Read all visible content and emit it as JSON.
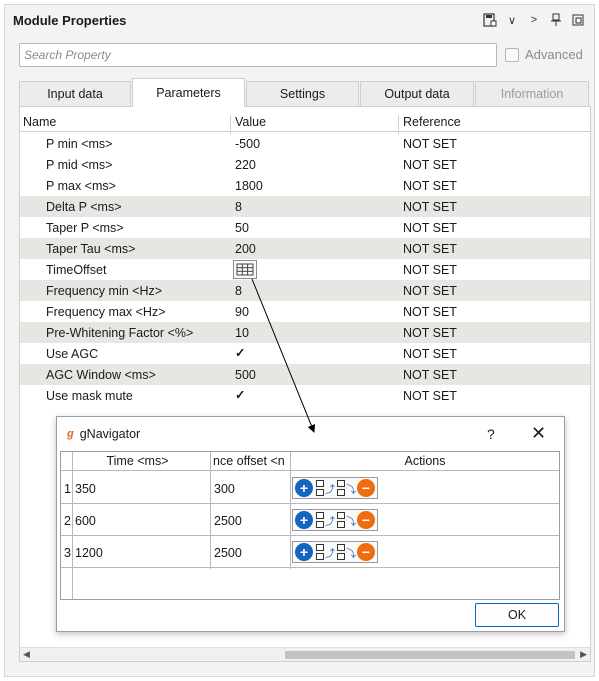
{
  "panel": {
    "title": "Module Properties",
    "toolbar_icons": [
      "save-icon",
      "chevron-down-icon",
      "chevron-right-icon",
      "pin-icon",
      "float-window-icon"
    ]
  },
  "search": {
    "placeholder": "Search Property"
  },
  "advanced": {
    "label": "Advanced",
    "checked": false
  },
  "tabs": [
    {
      "label": "Input data",
      "active": false,
      "enabled": true
    },
    {
      "label": "Parameters",
      "active": true,
      "enabled": true
    },
    {
      "label": "Settings",
      "active": false,
      "enabled": true
    },
    {
      "label": "Output data",
      "active": false,
      "enabled": true
    },
    {
      "label": "Information",
      "active": false,
      "enabled": false
    }
  ],
  "grid": {
    "headers": {
      "name": "Name",
      "value": "Value",
      "reference": "Reference"
    },
    "rows": [
      {
        "name": "P min <ms>",
        "value": "-500",
        "reference": "NOT SET"
      },
      {
        "name": "P mid <ms>",
        "value": "220",
        "reference": "NOT SET"
      },
      {
        "name": "P max <ms>",
        "value": "1800",
        "reference": "NOT SET"
      },
      {
        "name": "Delta P <ms>",
        "value": "8",
        "reference": "NOT SET"
      },
      {
        "name": "Taper P <ms>",
        "value": "50",
        "reference": "NOT SET"
      },
      {
        "name": "Taper Tau <ms>",
        "value": "200",
        "reference": "NOT SET"
      },
      {
        "name": "TimeOffset",
        "value": "",
        "reference": "NOT SET"
      },
      {
        "name": "Frequency min <Hz>",
        "value": "8",
        "reference": "NOT SET"
      },
      {
        "name": "Frequency max <Hz>",
        "value": "90",
        "reference": "NOT SET"
      },
      {
        "name": "Pre-Whitening Factor <%>",
        "value": "10",
        "reference": "NOT SET"
      },
      {
        "name": "Use AGC",
        "value": "✓",
        "reference": "NOT SET"
      },
      {
        "name": "AGC Window <ms>",
        "value": "500",
        "reference": "NOT SET"
      },
      {
        "name": "Use mask mute",
        "value": "✓",
        "reference": "NOT SET"
      }
    ]
  },
  "dialog": {
    "logo": "g",
    "title": "gNavigator",
    "help": "?",
    "close": "✕",
    "headers": {
      "time": "Time <ms>",
      "offset": "nce offset <n",
      "actions": "Actions"
    },
    "rows": [
      {
        "index": "1",
        "time": "350",
        "offset": "300"
      },
      {
        "index": "2",
        "time": "600",
        "offset": "2500"
      },
      {
        "index": "3",
        "time": "1200",
        "offset": "2500"
      }
    ],
    "ok_label": "OK"
  },
  "colors": {
    "accent": "#0a64b8",
    "add_button": "#1565c0",
    "remove_button": "#ef6c0f",
    "alt_row": "#e7e6e3"
  }
}
